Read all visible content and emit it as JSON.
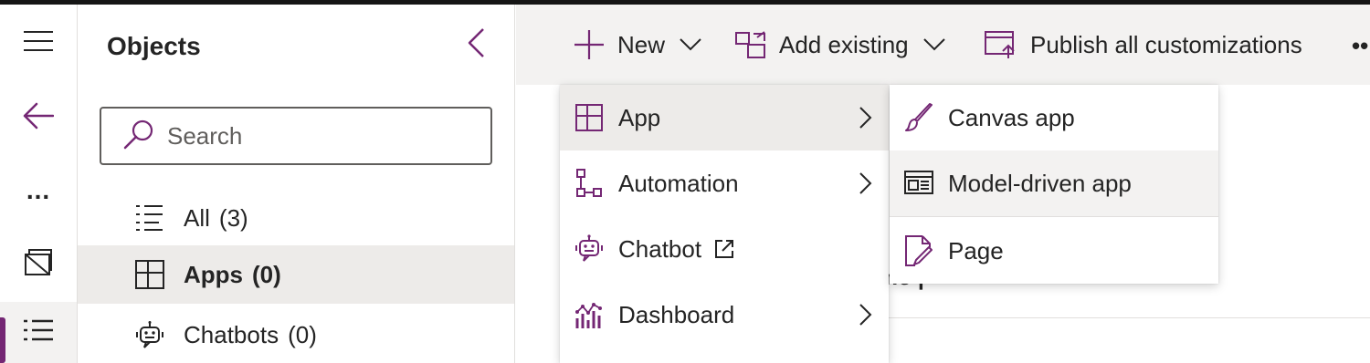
{
  "colors": {
    "accent": "#742774",
    "topbar": "#151515",
    "command_bar_bg": "#f3f2f1",
    "selected_bg": "#edebe9"
  },
  "rail": {
    "items": [
      {
        "icon": "hamburger-menu-icon"
      },
      {
        "icon": "back-arrow-icon"
      },
      {
        "icon": "more-dots-icon",
        "label": "..."
      },
      {
        "icon": "solutions-icon"
      },
      {
        "icon": "objects-list-icon",
        "active": true
      }
    ]
  },
  "objects_pane": {
    "title": "Objects",
    "search_placeholder": "Search",
    "items": [
      {
        "label": "All",
        "count": "(3)",
        "icon": "list-icon"
      },
      {
        "label": "Apps",
        "count": "(0)",
        "icon": "apps-grid-icon",
        "selected": true
      },
      {
        "label": "Chatbots",
        "count": "(0)",
        "icon": "bot-icon"
      }
    ]
  },
  "command_bar": {
    "new_label": "New",
    "add_existing_label": "Add existing",
    "publish_label": "Publish all customizations",
    "more_label": "••"
  },
  "background_content": {
    "partial_heading": "me |"
  },
  "new_menu": {
    "items": [
      {
        "label": "App",
        "icon": "app-grid-icon",
        "has_submenu": true,
        "hovered": true
      },
      {
        "label": "Automation",
        "icon": "automation-flow-icon",
        "has_submenu": true
      },
      {
        "label": "Chatbot",
        "icon": "chatbot-icon",
        "external": true
      },
      {
        "label": "Dashboard",
        "icon": "dashboard-chart-icon",
        "has_submenu": true
      }
    ]
  },
  "app_submenu": {
    "items": [
      {
        "label": "Canvas app",
        "icon": "paintbrush-icon"
      },
      {
        "label": "Model-driven app",
        "icon": "model-driven-app-icon",
        "hovered": true
      },
      {
        "label": "Page",
        "icon": "page-edit-icon"
      }
    ]
  }
}
